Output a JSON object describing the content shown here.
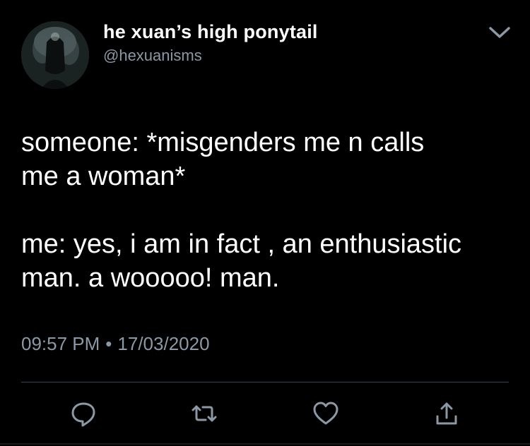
{
  "author": {
    "display_name": "he xuan’s high ponytail",
    "handle": "@hexuanisms"
  },
  "tweet": {
    "paragraph_1": "someone: *misgenders me n calls\nme a woman*",
    "paragraph_2": "me: yes, i am in fact , an enthusiastic\nman. a wooooo! man.",
    "time": "09:57 PM",
    "separator": "•",
    "date": "17/03/2020"
  },
  "actions": {
    "icons": [
      "reply-icon",
      "retweet-icon",
      "like-icon",
      "share-icon"
    ]
  },
  "colors": {
    "background": "#000000",
    "text": "#ffffff",
    "secondary_text": "#8b98a5",
    "icon": "#8b98a5",
    "divider": "#38444d"
  }
}
